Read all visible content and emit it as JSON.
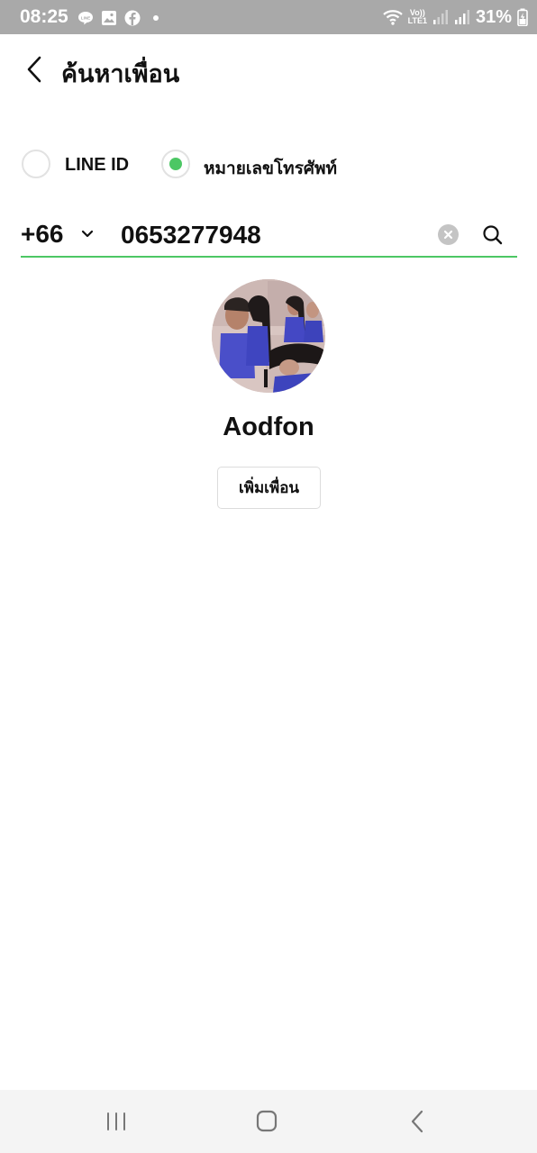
{
  "status_bar": {
    "time": "08:25",
    "icons": [
      "line-notification-icon",
      "gallery-notification-icon",
      "facebook-notification-icon",
      "dot-icon"
    ],
    "network": "VoLTE1",
    "volte_top": "Vo))",
    "volte_bottom": "LTE1",
    "battery": "31%"
  },
  "header": {
    "title": "ค้นหาเพื่อน"
  },
  "search_type": {
    "options": [
      {
        "label": "LINE ID",
        "selected": false
      },
      {
        "label": "หมายเลขโทรศัพท์",
        "selected": true
      }
    ]
  },
  "phone_search": {
    "country_code": "+66",
    "value": "0653277948"
  },
  "result": {
    "name": "Aodfon",
    "add_button_label": "เพิ่มเพื่อน"
  },
  "colors": {
    "accent": "#4cc764",
    "status_bar": "#a9a9a9",
    "nav_bar": "#f4f4f4"
  }
}
